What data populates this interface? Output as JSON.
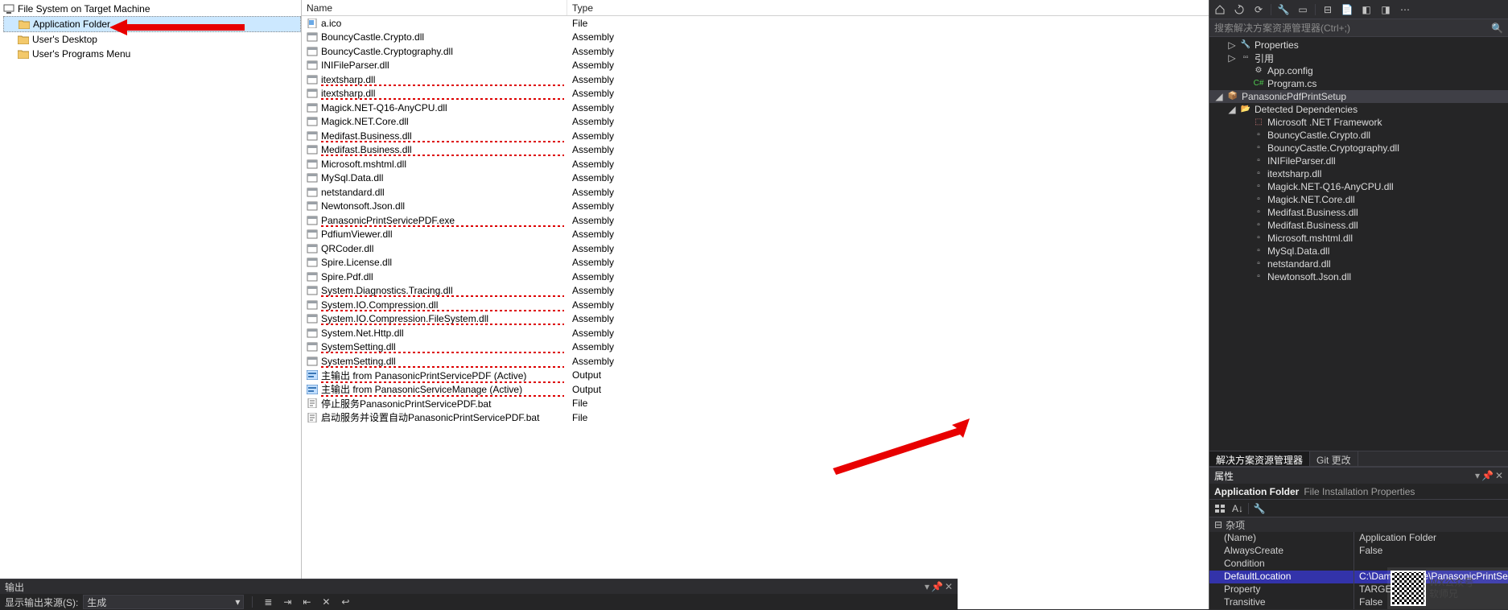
{
  "left_tree": {
    "root": "File System on Target Machine",
    "folders": [
      {
        "label": "Application Folder",
        "selected": true
      },
      {
        "label": "User's Desktop",
        "selected": false
      },
      {
        "label": "User's Programs Menu",
        "selected": false
      }
    ]
  },
  "file_list": {
    "headers": {
      "name": "Name",
      "type": "Type"
    },
    "rows": [
      {
        "name": "a.ico",
        "type": "File",
        "icon": "file",
        "spell": false
      },
      {
        "name": "BouncyCastle.Crypto.dll",
        "type": "Assembly",
        "icon": "asm",
        "spell": false
      },
      {
        "name": "BouncyCastle.Cryptography.dll",
        "type": "Assembly",
        "icon": "asm",
        "spell": false
      },
      {
        "name": "INIFileParser.dll",
        "type": "Assembly",
        "icon": "asm",
        "spell": false
      },
      {
        "name": "itextsharp.dll",
        "type": "Assembly",
        "icon": "asm",
        "spell": true
      },
      {
        "name": "itextsharp.dll",
        "type": "Assembly",
        "icon": "asm",
        "spell": true
      },
      {
        "name": "Magick.NET-Q16-AnyCPU.dll",
        "type": "Assembly",
        "icon": "asm",
        "spell": false
      },
      {
        "name": "Magick.NET.Core.dll",
        "type": "Assembly",
        "icon": "asm",
        "spell": false
      },
      {
        "name": "Medifast.Business.dll",
        "type": "Assembly",
        "icon": "asm",
        "spell": true
      },
      {
        "name": "Medifast.Business.dll",
        "type": "Assembly",
        "icon": "asm",
        "spell": true
      },
      {
        "name": "Microsoft.mshtml.dll",
        "type": "Assembly",
        "icon": "asm",
        "spell": false
      },
      {
        "name": "MySql.Data.dll",
        "type": "Assembly",
        "icon": "asm",
        "spell": false
      },
      {
        "name": "netstandard.dll",
        "type": "Assembly",
        "icon": "asm",
        "spell": false
      },
      {
        "name": "Newtonsoft.Json.dll",
        "type": "Assembly",
        "icon": "asm",
        "spell": false
      },
      {
        "name": "PanasonicPrintServicePDF.exe",
        "type": "Assembly",
        "icon": "asm",
        "spell": true
      },
      {
        "name": "PdfiumViewer.dll",
        "type": "Assembly",
        "icon": "asm",
        "spell": false
      },
      {
        "name": "QRCoder.dll",
        "type": "Assembly",
        "icon": "asm",
        "spell": false
      },
      {
        "name": "Spire.License.dll",
        "type": "Assembly",
        "icon": "asm",
        "spell": false
      },
      {
        "name": "Spire.Pdf.dll",
        "type": "Assembly",
        "icon": "asm",
        "spell": false
      },
      {
        "name": "System.Diagnostics.Tracing.dll",
        "type": "Assembly",
        "icon": "asm",
        "spell": true
      },
      {
        "name": "System.IO.Compression.dll",
        "type": "Assembly",
        "icon": "asm",
        "spell": true
      },
      {
        "name": "System.IO.Compression.FileSystem.dll",
        "type": "Assembly",
        "icon": "asm",
        "spell": true
      },
      {
        "name": "System.Net.Http.dll",
        "type": "Assembly",
        "icon": "asm",
        "spell": false
      },
      {
        "name": "SystemSetting.dll",
        "type": "Assembly",
        "icon": "asm",
        "spell": true
      },
      {
        "name": "SystemSetting.dll",
        "type": "Assembly",
        "icon": "asm",
        "spell": true
      },
      {
        "name": "主输出 from PanasonicPrintServicePDF (Active)",
        "type": "Output",
        "icon": "out",
        "spell": true
      },
      {
        "name": "主输出 from PanasonicServiceManage (Active)",
        "type": "Output",
        "icon": "out",
        "spell": true
      },
      {
        "name": "停止服务PanasonicPrintServicePDF.bat",
        "type": "File",
        "icon": "bat",
        "spell": false
      },
      {
        "name": "启动服务并设置自动PanasonicPrintServicePDF.bat",
        "type": "File",
        "icon": "bat",
        "spell": false
      }
    ]
  },
  "solution_explorer": {
    "search_placeholder": "搜索解决方案资源管理器(Ctrl+;)",
    "nodes": [
      {
        "indent": 1,
        "twisty": "▷",
        "icon": "wrench",
        "label": "Properties"
      },
      {
        "indent": 1,
        "twisty": "▷",
        "icon": "ref",
        "label": "引用"
      },
      {
        "indent": 2,
        "twisty": "",
        "icon": "cfg",
        "label": "App.config"
      },
      {
        "indent": 2,
        "twisty": "",
        "icon": "cs",
        "label": "Program.cs"
      },
      {
        "indent": 0,
        "twisty": "◢",
        "icon": "proj",
        "label": "PanasonicPdfPrintSetup",
        "sel": true
      },
      {
        "indent": 1,
        "twisty": "◢",
        "icon": "folder",
        "label": "Detected Dependencies"
      },
      {
        "indent": 2,
        "twisty": "",
        "icon": "net",
        "label": "Microsoft .NET Framework"
      },
      {
        "indent": 2,
        "twisty": "",
        "icon": "dll",
        "label": "BouncyCastle.Crypto.dll"
      },
      {
        "indent": 2,
        "twisty": "",
        "icon": "dll",
        "label": "BouncyCastle.Cryptography.dll"
      },
      {
        "indent": 2,
        "twisty": "",
        "icon": "dll",
        "label": "INIFileParser.dll"
      },
      {
        "indent": 2,
        "twisty": "",
        "icon": "dll",
        "label": "itextsharp.dll"
      },
      {
        "indent": 2,
        "twisty": "",
        "icon": "dll",
        "label": "Magick.NET-Q16-AnyCPU.dll"
      },
      {
        "indent": 2,
        "twisty": "",
        "icon": "dll",
        "label": "Magick.NET.Core.dll"
      },
      {
        "indent": 2,
        "twisty": "",
        "icon": "dll",
        "label": "Medifast.Business.dll"
      },
      {
        "indent": 2,
        "twisty": "",
        "icon": "dll",
        "label": "Medifast.Business.dll"
      },
      {
        "indent": 2,
        "twisty": "",
        "icon": "dll",
        "label": "Microsoft.mshtml.dll"
      },
      {
        "indent": 2,
        "twisty": "",
        "icon": "dll",
        "label": "MySql.Data.dll"
      },
      {
        "indent": 2,
        "twisty": "",
        "icon": "dll",
        "label": "netstandard.dll"
      },
      {
        "indent": 2,
        "twisty": "",
        "icon": "dll",
        "label": "Newtonsoft.Json.dll"
      }
    ],
    "tabs": [
      {
        "label": "解决方案资源管理器",
        "active": true
      },
      {
        "label": "Git 更改",
        "active": false
      }
    ]
  },
  "properties": {
    "pane_title": "属性",
    "object_bold": "Application Folder",
    "object_grey": "File Installation Properties",
    "category": "杂项",
    "rows": [
      {
        "name": "(Name)",
        "val": "Application Folder",
        "selected": false
      },
      {
        "name": "AlwaysCreate",
        "val": "False",
        "selected": false
      },
      {
        "name": "Condition",
        "val": "",
        "selected": false
      },
      {
        "name": "DefaultLocation",
        "val": "C:\\Damsonware\\PanasonicPrintServiceP",
        "selected": true
      },
      {
        "name": "Property",
        "val": "TARGETDIR",
        "selected": false
      },
      {
        "name": "Transitive",
        "val": "False",
        "selected": false
      }
    ]
  },
  "output": {
    "title": "输出",
    "label": "显示输出来源(S):",
    "combo": "生成"
  },
  "watermark": {
    "line1": "WX公众号",
    "line2": "软师兄"
  }
}
